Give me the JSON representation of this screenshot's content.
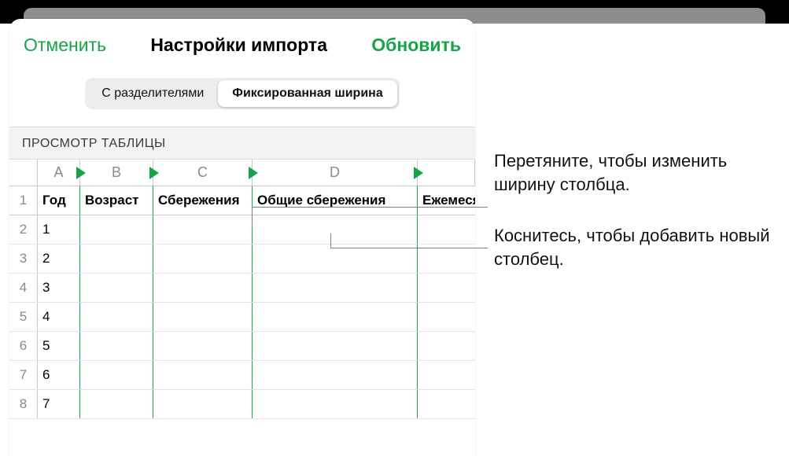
{
  "header": {
    "cancel": "Отменить",
    "title": "Настройки импорта",
    "update": "Обновить"
  },
  "segmented": {
    "delimited": "С разделителями",
    "fixed": "Фиксированная ширина"
  },
  "section_label": "ПРОСМОТР ТАБЛИЦЫ",
  "columns": [
    "A",
    "B",
    "C",
    "D"
  ],
  "header_row": [
    "Год",
    "Возраст",
    "Сбережения",
    "Общие сбережения",
    "Ежемеся"
  ],
  "data_rows": [
    "1",
    "2",
    "3",
    "4",
    "5",
    "6",
    "7"
  ],
  "callouts": {
    "drag": "Перетяните, чтобы изменить ширину столбца.",
    "tap": "Коснитесь, чтобы добавить новый столбец."
  }
}
